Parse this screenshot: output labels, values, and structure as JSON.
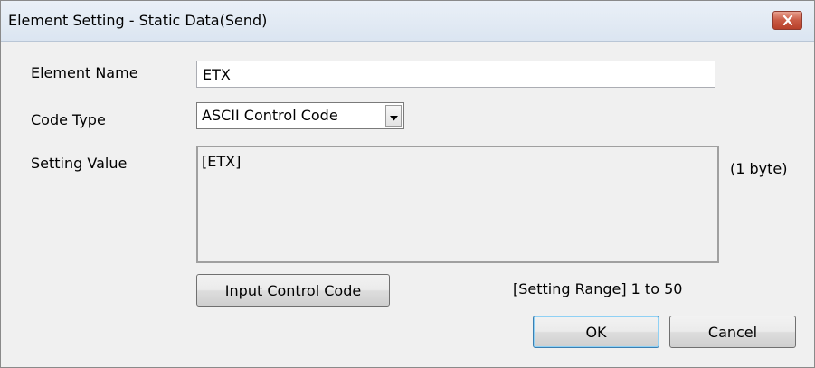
{
  "window": {
    "title": "Element Setting - Static Data(Send)",
    "close_icon": "close-x-icon"
  },
  "form": {
    "element_name_label": "Element Name",
    "element_name_value": "ETX",
    "code_type_label": "Code Type",
    "code_type_value": "ASCII Control Code",
    "setting_value_label": "Setting Value",
    "setting_value_text": "[ETX]",
    "byte_count": "(1 byte)",
    "setting_range": "[Setting Range] 1 to 50"
  },
  "buttons": {
    "input_control_code": "Input Control Code",
    "ok": "OK",
    "cancel": "Cancel"
  },
  "colors": {
    "dialog_bg": "#f0f0f0",
    "close_button": "#c95a44"
  }
}
